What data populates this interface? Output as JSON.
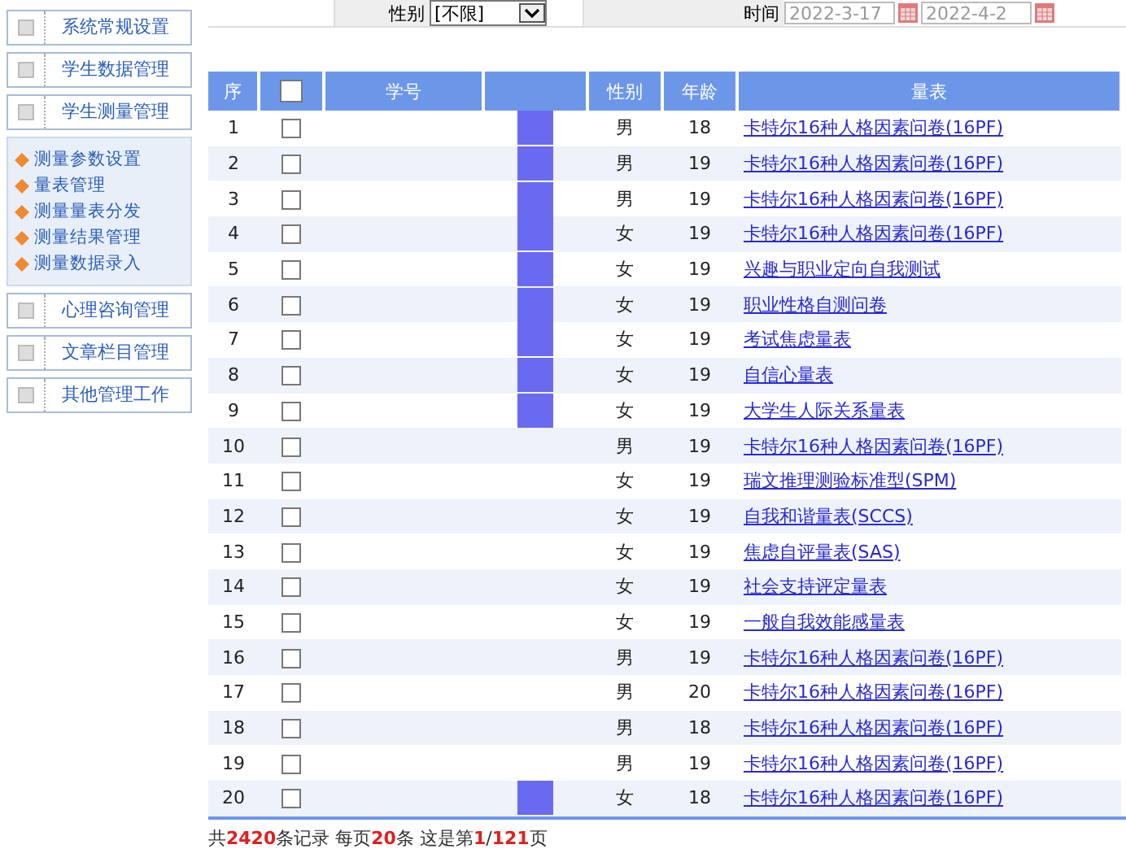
{
  "sidebar": {
    "sections": [
      {
        "label": "系统常规设置"
      },
      {
        "label": "学生数据管理"
      },
      {
        "label": "学生测量管理",
        "items": [
          "测量参数设置",
          "量表管理",
          "测量量表分发",
          "测量结果管理",
          "测量数据录入"
        ]
      },
      {
        "label": "心理咨询管理"
      },
      {
        "label": "文章栏目管理"
      },
      {
        "label": "其他管理工作"
      }
    ]
  },
  "filters": {
    "gender_label": "性别",
    "gender_value": "[不限]",
    "time_label": "时间",
    "date_from": {
      "placeholder": "2022-3-17"
    },
    "date_to": {
      "placeholder": "2022-4-2"
    }
  },
  "table": {
    "columns": [
      "序",
      "",
      "学号",
      "",
      "性别",
      "年龄",
      "量表"
    ],
    "select_all_checked": false,
    "rows": [
      {
        "index": "1",
        "checked": false,
        "masked": true,
        "gender": "男",
        "age": "18",
        "scale": "卡特尔16种人格因素问卷(16PF)"
      },
      {
        "index": "2",
        "checked": false,
        "masked": true,
        "gender": "男",
        "age": "19",
        "scale": "卡特尔16种人格因素问卷(16PF)"
      },
      {
        "index": "3",
        "checked": false,
        "masked": true,
        "gender": "男",
        "age": "19",
        "scale": "卡特尔16种人格因素问卷(16PF)"
      },
      {
        "index": "4",
        "checked": false,
        "masked": true,
        "gender": "女",
        "age": "19",
        "scale": "卡特尔16种人格因素问卷(16PF)"
      },
      {
        "index": "5",
        "checked": false,
        "masked": true,
        "gender": "女",
        "age": "19",
        "scale": "兴趣与职业定向自我测试"
      },
      {
        "index": "6",
        "checked": false,
        "masked": true,
        "gender": "女",
        "age": "19",
        "scale": "职业性格自测问卷"
      },
      {
        "index": "7",
        "checked": false,
        "masked": true,
        "gender": "女",
        "age": "19",
        "scale": "考试焦虑量表"
      },
      {
        "index": "8",
        "checked": false,
        "masked": true,
        "gender": "女",
        "age": "19",
        "scale": "自信心量表"
      },
      {
        "index": "9",
        "checked": false,
        "masked": true,
        "gender": "女",
        "age": "19",
        "scale": "大学生人际关系量表"
      },
      {
        "index": "10",
        "checked": false,
        "masked": false,
        "gender": "男",
        "age": "19",
        "scale": "卡特尔16种人格因素问卷(16PF)"
      },
      {
        "index": "11",
        "checked": false,
        "masked": false,
        "gender": "女",
        "age": "19",
        "scale": "瑞文推理测验标准型(SPM)"
      },
      {
        "index": "12",
        "checked": false,
        "masked": false,
        "gender": "女",
        "age": "19",
        "scale": "自我和谐量表(SCCS)"
      },
      {
        "index": "13",
        "checked": false,
        "masked": false,
        "gender": "女",
        "age": "19",
        "scale": "焦虑自评量表(SAS)"
      },
      {
        "index": "14",
        "checked": false,
        "masked": false,
        "gender": "女",
        "age": "19",
        "scale": "社会支持评定量表"
      },
      {
        "index": "15",
        "checked": false,
        "masked": false,
        "gender": "女",
        "age": "19",
        "scale": "一般自我效能感量表"
      },
      {
        "index": "16",
        "checked": false,
        "masked": false,
        "gender": "男",
        "age": "19",
        "scale": "卡特尔16种人格因素问卷(16PF)"
      },
      {
        "index": "17",
        "checked": false,
        "masked": false,
        "gender": "男",
        "age": "20",
        "scale": "卡特尔16种人格因素问卷(16PF)"
      },
      {
        "index": "18",
        "checked": false,
        "masked": false,
        "gender": "男",
        "age": "18",
        "scale": "卡特尔16种人格因素问卷(16PF)"
      },
      {
        "index": "19",
        "checked": false,
        "masked": false,
        "gender": "男",
        "age": "19",
        "scale": "卡特尔16种人格因素问卷(16PF)"
      },
      {
        "index": "20",
        "checked": false,
        "masked": true,
        "gender": "女",
        "age": "18",
        "scale": "卡特尔16种人格因素问卷(16PF)"
      }
    ]
  },
  "pager": {
    "text": "共**2420**条记录 每页**20**条 这是第**1**/**121**页"
  }
}
